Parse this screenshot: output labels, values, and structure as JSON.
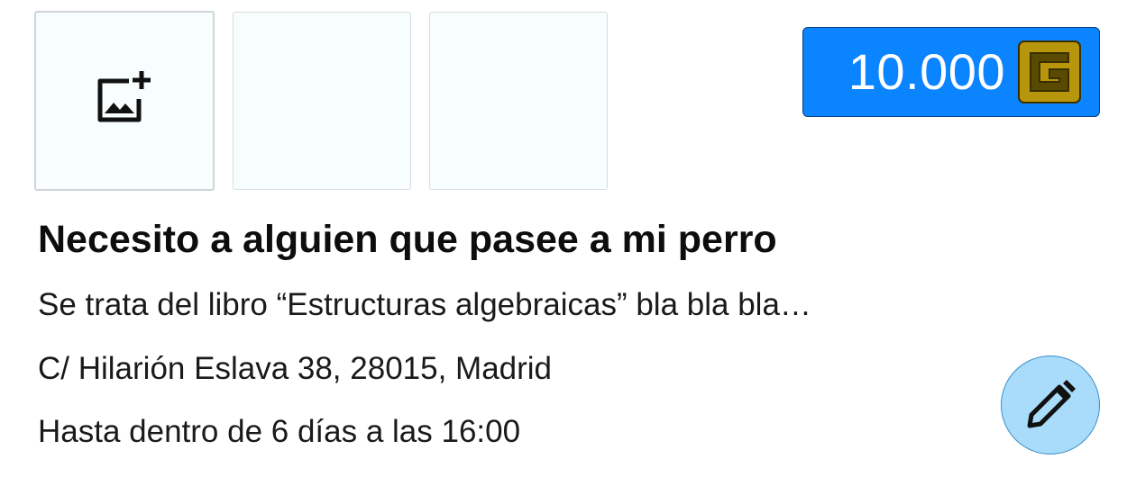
{
  "images": {
    "add_icon": "add-photo-icon",
    "slots": [
      "add-photo",
      "empty",
      "empty"
    ]
  },
  "price": {
    "amount": "10.000",
    "currency_icon": "coin-g-icon",
    "badge_color": "#0a84ff",
    "coin_color": "#b8960c"
  },
  "task": {
    "title": "Necesito a alguien que pasee a mi perro",
    "description": "Se trata del libro “Estructuras algebraicas” bla bla bla…",
    "address": "C/ Hilarión Eslava 38, 28015, Madrid",
    "deadline": "Hasta dentro de 6 días a las 16:00"
  },
  "actions": {
    "edit_icon": "pencil-icon",
    "edit_color": "#a9dcfb"
  }
}
